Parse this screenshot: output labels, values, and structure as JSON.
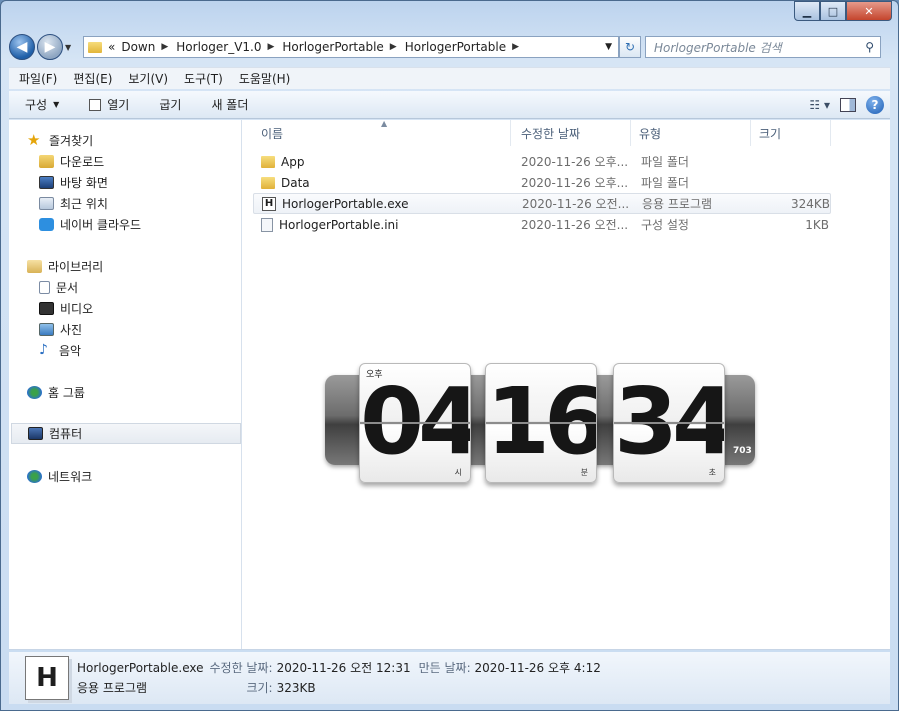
{
  "window": {
    "minimize": "▁",
    "maximize": "□",
    "close": "✕"
  },
  "address": {
    "back": "◀",
    "forward": "▶",
    "overflow": "«",
    "crumbs": [
      "Down",
      "Horloger_V1.0",
      "HorlogerPortable",
      "HorlogerPortable"
    ],
    "search_placeholder": "HorlogerPortable 검색"
  },
  "menu": [
    "파일(F)",
    "편집(E)",
    "보기(V)",
    "도구(T)",
    "도움말(H)"
  ],
  "commands": {
    "organize": "구성",
    "open": "열기",
    "burn": "굽기",
    "new_folder": "새 폴더"
  },
  "sidebar": {
    "favorites": {
      "label": "즐겨찾기",
      "items": [
        "다운로드",
        "바탕 화면",
        "최근 위치",
        "네이버 클라우드"
      ]
    },
    "libraries": {
      "label": "라이브러리",
      "items": [
        "문서",
        "비디오",
        "사진",
        "음악"
      ]
    },
    "homegroup": "홈 그룹",
    "computer": "컴퓨터",
    "network": "네트워크"
  },
  "columns": {
    "name": "이름",
    "date": "수정한 날짜",
    "type": "유형",
    "size": "크기"
  },
  "files": [
    {
      "name": "App",
      "date": "2020-11-26 오후...",
      "type": "파일 폴더",
      "size": "",
      "icon": "folder-icon"
    },
    {
      "name": "Data",
      "date": "2020-11-26 오후...",
      "type": "파일 폴더",
      "size": "",
      "icon": "folder-icon"
    },
    {
      "name": "HorlogerPortable.exe",
      "date": "2020-11-26 오전...",
      "type": "응용 프로그램",
      "size": "324KB",
      "icon": "exe-icon"
    },
    {
      "name": "HorlogerPortable.ini",
      "date": "2020-11-26 오전...",
      "type": "구성 설정",
      "size": "1KB",
      "icon": "settings-file-icon"
    }
  ],
  "clock": {
    "ampm": "오후",
    "hours": "04",
    "minutes": "16",
    "seconds": "34",
    "hour_unit": "시",
    "minute_unit": "분",
    "second_unit": "초",
    "millis": "703"
  },
  "details": {
    "icon_letter": "H",
    "filename": "HorlogerPortable.exe",
    "filetype": "응용 프로그램",
    "modified_label": "수정한 날짜:",
    "modified_value": "2020-11-26 오전 12:31",
    "size_label": "크기:",
    "size_value": "323KB",
    "created_label": "만든 날짜:",
    "created_value": "2020-11-26 오후 4:12"
  }
}
